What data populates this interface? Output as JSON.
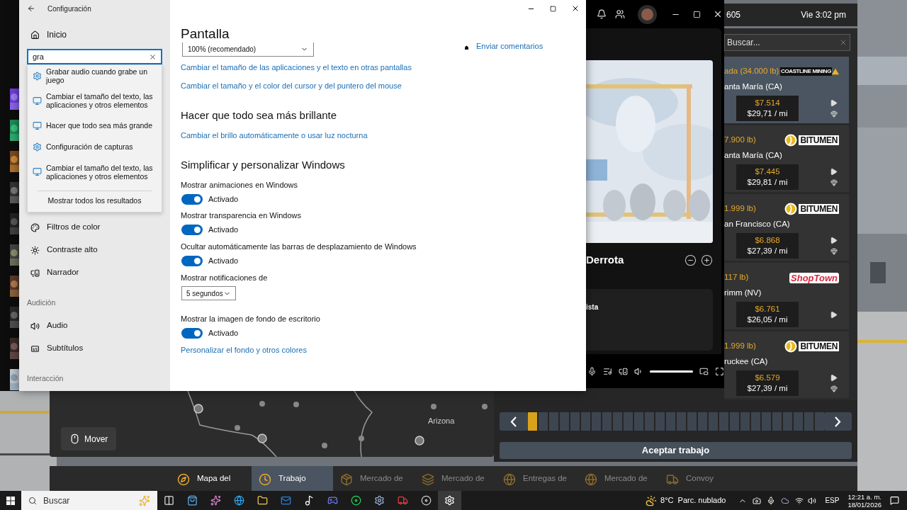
{
  "settings": {
    "title": "Configuración",
    "home": "Inicio",
    "search": {
      "value": "gra"
    },
    "suggestions": [
      {
        "kind": "setting",
        "text": "Grabar audio cuando grabe un juego"
      },
      {
        "kind": "display",
        "text": "Cambiar el tamaño del texto, las aplicaciones y otros elementos"
      },
      {
        "kind": "display",
        "text": "Hacer que todo sea más grande"
      },
      {
        "kind": "setting",
        "text": "Configuración de capturas"
      },
      {
        "kind": "display",
        "text": "Cambiar el tamaño del texto, las aplicaciones y otros elementos"
      }
    ],
    "show_all": "Mostrar todos los resultados",
    "nav": [
      {
        "kind": "item",
        "label": "Filtros de color"
      },
      {
        "kind": "item",
        "label": "Contraste alto"
      },
      {
        "kind": "item",
        "label": "Narrador"
      },
      {
        "kind": "header",
        "label": "Audición"
      },
      {
        "kind": "item",
        "label": "Audio"
      },
      {
        "kind": "item",
        "label": "Subtítulos"
      },
      {
        "kind": "header",
        "label": "Interacción"
      }
    ],
    "page_title": "Pantalla",
    "scale": "100% (recomendado)",
    "feedback": "Enviar comentarios",
    "blocks": [
      {
        "kind": "link",
        "text": "Cambiar el tamaño de las aplicaciones y el texto en otras pantallas"
      },
      {
        "kind": "link",
        "text": "Cambiar el tamaño y el color del cursor y del puntero del mouse"
      },
      {
        "kind": "heading",
        "text": "Hacer que todo sea más brillante"
      },
      {
        "kind": "link",
        "text": "Cambiar el brillo automáticamente o usar luz nocturna"
      },
      {
        "kind": "heading",
        "text": "Simplificar y personalizar Windows"
      },
      {
        "kind": "toggle",
        "label": "Mostrar animaciones en Windows",
        "on": true,
        "state": "Activado"
      },
      {
        "kind": "toggle",
        "label": "Mostrar transparencia en Windows",
        "on": true,
        "state": "Activado"
      },
      {
        "kind": "toggle",
        "label": "Ocultar automáticamente las barras de desplazamiento de Windows",
        "on": true,
        "state": "Activado"
      },
      {
        "kind": "select",
        "label": "Mostrar notificaciones de",
        "value": "5 segundos"
      },
      {
        "kind": "toggle",
        "label": "Mostrar la imagen de fondo de escritorio",
        "on": true,
        "state": "Activado"
      },
      {
        "kind": "link",
        "text": "Personalizar el fondo y otros colores"
      }
    ]
  },
  "player": {
    "title": "Derrota",
    "section": "ista",
    "volume": {
      "level": 1
    }
  },
  "game": {
    "top_bar": {
      "number": "605",
      "clock": "Vie 3:02 pm"
    },
    "job_search": {
      "placeholder": "Buscar..."
    },
    "jobs": [
      {
        "weight": "ada (34.000 lb)",
        "logo": {
          "kind": "mining",
          "text": "COASTLINE MINING"
        },
        "city": "anta María (CA)",
        "price": "$7.514",
        "rate": "$29,71 / mi",
        "selected": true,
        "gem": true
      },
      {
        "weight": "7.900 lb)",
        "logo": {
          "kind": "bitumen",
          "text": "BITUMEN"
        },
        "city": "anta María (CA)",
        "price": "$7.445",
        "rate": "$29,81 / mi",
        "selected": false,
        "gem": true
      },
      {
        "weight": "1.999 lb)",
        "logo": {
          "kind": "bitumen",
          "text": "BITUMEN"
        },
        "city": "an Francisco (CA)",
        "price": "$6.868",
        "rate": "$27,39 / mi",
        "selected": false,
        "gem": true
      },
      {
        "weight": "117 lb)",
        "logo": {
          "kind": "shoptown",
          "text": "ShopTown"
        },
        "city": "rimm (NV)",
        "price": "$6.761",
        "rate": "$26,05 / mi",
        "selected": false,
        "gem": false
      },
      {
        "weight": "1.999 lb)",
        "logo": {
          "kind": "bitumen",
          "text": "BITUMEN"
        },
        "city": "ruckee (CA)",
        "price": "$6.579",
        "rate": "$27,39 / mi",
        "selected": false,
        "gem": true
      }
    ],
    "pages": [
      {
        "selected": true
      },
      {
        "selected": false
      },
      {
        "selected": false
      },
      {
        "selected": false
      },
      {
        "selected": false
      },
      {
        "selected": false
      },
      {
        "selected": false
      },
      {
        "selected": false
      },
      {
        "selected": false
      },
      {
        "selected": false
      },
      {
        "selected": false
      },
      {
        "selected": false
      },
      {
        "selected": false
      },
      {
        "selected": false
      },
      {
        "selected": false
      },
      {
        "selected": false
      },
      {
        "selected": false
      },
      {
        "selected": false
      },
      {
        "selected": false
      },
      {
        "selected": false
      },
      {
        "selected": false
      },
      {
        "selected": false
      },
      {
        "selected": false
      },
      {
        "selected": false
      },
      {
        "selected": false
      },
      {
        "selected": false
      },
      {
        "selected": false
      },
      {
        "selected": false
      }
    ],
    "accept": "Aceptar trabajo",
    "map": {
      "region": "Arizona",
      "move": "Mover"
    },
    "tabs": [
      {
        "label": "Mapa del",
        "selected": false,
        "dimmed": false
      },
      {
        "label": "Trabajo",
        "selected": true,
        "dimmed": false
      },
      {
        "label": "Mercado de",
        "selected": false,
        "dimmed": true
      },
      {
        "label": "Mercado de",
        "selected": false,
        "dimmed": true
      },
      {
        "label": "Entregas de",
        "selected": false,
        "dimmed": true
      },
      {
        "label": "Mercado de",
        "selected": false,
        "dimmed": true
      },
      {
        "label": "Convoy",
        "selected": false,
        "dimmed": true
      }
    ]
  },
  "taskbar": {
    "search_placeholder": "Buscar",
    "apps": [
      {
        "selected": false
      },
      {
        "selected": false
      },
      {
        "selected": false
      },
      {
        "selected": false
      },
      {
        "selected": false
      },
      {
        "selected": false
      },
      {
        "selected": false
      },
      {
        "selected": false
      },
      {
        "selected": false
      },
      {
        "selected": false
      },
      {
        "selected": false
      },
      {
        "selected": false
      },
      {
        "selected": true
      }
    ],
    "temperature": "8°C",
    "weather": "Parc. nublado",
    "language": "ESP",
    "time": "12:21 a. m.",
    "date": "18/01/2026"
  }
}
